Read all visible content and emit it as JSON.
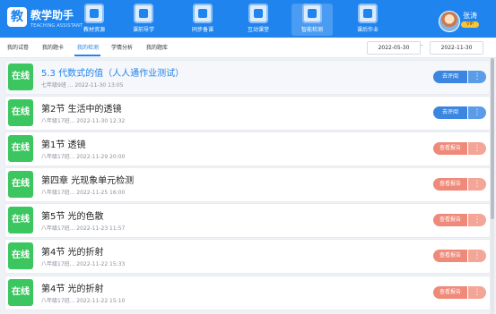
{
  "app": {
    "logo_char": "教",
    "name": "教学助手",
    "subtitle": "TEACHING ASSISTANT"
  },
  "nav": [
    {
      "label": "教材资源",
      "icon": "book-icon"
    },
    {
      "label": "课前导学",
      "icon": "upload-icon"
    },
    {
      "label": "同步备课",
      "icon": "pencil-icon"
    },
    {
      "label": "互动课堂",
      "icon": "monitor-icon"
    },
    {
      "label": "智能检测",
      "icon": "check-icon"
    },
    {
      "label": "课后作业",
      "icon": "homework-icon"
    }
  ],
  "user": {
    "name": "张涛",
    "badge": "VIP"
  },
  "tabs": [
    "我的试卷",
    "我的题卡",
    "我的检测",
    "学情分析",
    "我的题库"
  ],
  "date_range": {
    "start": "2022-05-30",
    "separator": "-",
    "end": "2022-11-30"
  },
  "items": [
    {
      "status": "在线",
      "title": "5.3 代数式的值（人人通作业测试）",
      "sub": "七年级9班 ...   2022-11-30 13:05",
      "action": "去评阅",
      "more": "⋮"
    },
    {
      "status": "在线",
      "title": "第2节 生活中的透镜",
      "sub": "八年级17班...   2022-11-30 12:32",
      "action": "去评阅",
      "more": "⋮"
    },
    {
      "status": "在线",
      "title": "第1节 透镜",
      "sub": "八年级17班...   2022-11-29 20:00",
      "action": "查看报告",
      "more": "⋮"
    },
    {
      "status": "在线",
      "title": "第四章 光现象单元检测",
      "sub": "八年级17班...   2022-11-25 16:00",
      "action": "查看报告",
      "more": "⋮"
    },
    {
      "status": "在线",
      "title": "第5节 光的色散",
      "sub": "八年级17班...   2022-11-23 11:57",
      "action": "查看报告",
      "more": "⋮"
    },
    {
      "status": "在线",
      "title": "第4节 光的折射",
      "sub": "八年级17班...   2022-11-22 15:33",
      "action": "查看报告",
      "more": "⋮"
    },
    {
      "status": "在线",
      "title": "第4节 光的折射",
      "sub": "八年级17班...   2022-11-22 15:10",
      "action": "查看报告",
      "more": "⋮"
    }
  ],
  "colors": {
    "primary": "#1f84ee",
    "online": "#3cc660",
    "review": "#3a86e0",
    "report": "#ef8a7a"
  }
}
